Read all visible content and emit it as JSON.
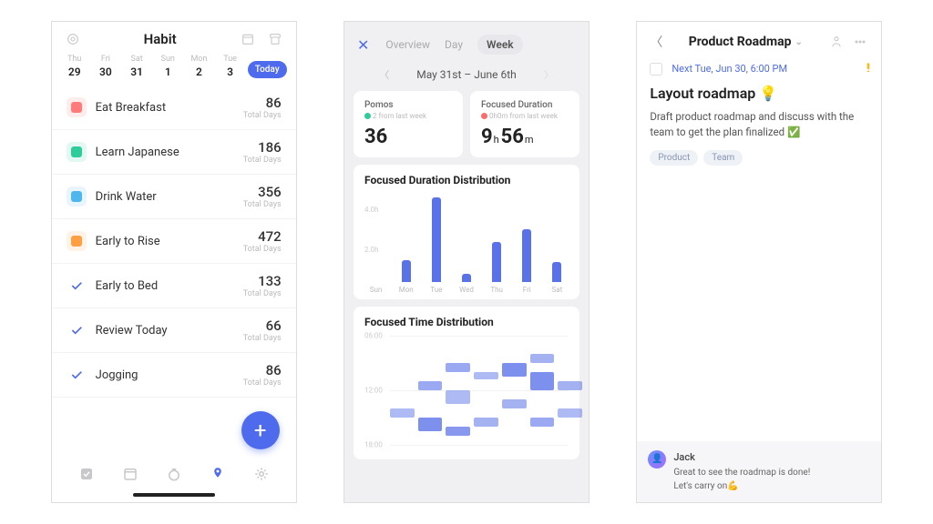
{
  "phone1": {
    "title": "Habit",
    "days": [
      {
        "dow": "Thu",
        "num": "29"
      },
      {
        "dow": "Fri",
        "num": "30"
      },
      {
        "dow": "Sat",
        "num": "31"
      },
      {
        "dow": "Sun",
        "num": "1"
      },
      {
        "dow": "Mon",
        "num": "2"
      },
      {
        "dow": "Tue",
        "num": "3"
      }
    ],
    "today_label": "Today",
    "habits": [
      {
        "title": "Eat Breakfast",
        "count": "86",
        "color": "#ff7b7b",
        "type": "box"
      },
      {
        "title": "Learn Japanese",
        "count": "186",
        "color": "#2ecc9b",
        "type": "box"
      },
      {
        "title": "Drink Water",
        "count": "356",
        "color": "#4fb7ed",
        "type": "box"
      },
      {
        "title": "Early to Rise",
        "count": "472",
        "color": "#ff9f43",
        "type": "box"
      },
      {
        "title": "Early to Bed",
        "count": "133",
        "color": "",
        "type": "check"
      },
      {
        "title": "Review Today",
        "count": "66",
        "color": "",
        "type": "check"
      },
      {
        "title": "Jogging",
        "count": "86",
        "color": "",
        "type": "check"
      }
    ],
    "sub_label": "Total Days",
    "fab": "+"
  },
  "phone2": {
    "tabs": [
      "Overview",
      "Day",
      "Week"
    ],
    "active_tab": "Week",
    "range": "May 31st – June 6th",
    "cards": [
      {
        "label": "Pomos",
        "delta": "2 from last week",
        "delta_color": "#2ecc9b",
        "value": "36"
      },
      {
        "label": "Focused Duration",
        "delta": "0h0m from last week",
        "delta_color": "#ff6b6b",
        "value_h": "9",
        "value_m": "56"
      }
    ],
    "chart1_title": "Focused Duration Distribution",
    "chart2_title": "Focused Time Distribution",
    "time_labels": [
      "06:00",
      "12:00",
      "18:00"
    ]
  },
  "phone3": {
    "title": "Product Roadmap",
    "due": "Next Tue, Jun 30, 6:00 PM",
    "priority": "!!",
    "task_title": "Layout roadmap",
    "task_emoji": "💡",
    "task_desc": "Draft product roadmap and discuss with the team to get the plan finalized ✅",
    "tags": [
      "Product",
      "Team"
    ],
    "comment": {
      "name": "Jack",
      "line1": "Great to see the roadmap is done!",
      "line2": "Let's carry on💪"
    }
  },
  "chart_data": [
    {
      "type": "bar",
      "title": "Focused Duration Distribution",
      "categories": [
        "Sun",
        "Mon",
        "Tue",
        "Wed",
        "Thu",
        "Fri",
        "Sat"
      ],
      "values": [
        0,
        1.1,
        4.2,
        0.4,
        2.0,
        2.6,
        1.0
      ],
      "ylabel": "h",
      "ylim": [
        0,
        4.5
      ],
      "yticks": [
        2.0,
        4.0
      ]
    },
    {
      "type": "heatmap",
      "title": "Focused Time Distribution",
      "x_categories": [
        "Sun",
        "Mon",
        "Tue",
        "Wed",
        "Thu",
        "Fri",
        "Sat"
      ],
      "y_labels": [
        "06:00",
        "12:00",
        "18:00"
      ],
      "blocks": [
        {
          "day": "Sun",
          "start": 14,
          "len": 1,
          "intensity": 0.4
        },
        {
          "day": "Mon",
          "start": 11,
          "len": 1,
          "intensity": 0.6
        },
        {
          "day": "Mon",
          "start": 15,
          "len": 1.5,
          "intensity": 0.9
        },
        {
          "day": "Tue",
          "start": 9,
          "len": 1,
          "intensity": 0.6
        },
        {
          "day": "Tue",
          "start": 12,
          "len": 1.5,
          "intensity": 0.4
        },
        {
          "day": "Tue",
          "start": 16,
          "len": 1,
          "intensity": 0.8
        },
        {
          "day": "Wed",
          "start": 10,
          "len": 0.8,
          "intensity": 0.4
        },
        {
          "day": "Wed",
          "start": 15,
          "len": 1,
          "intensity": 0.5
        },
        {
          "day": "Thu",
          "start": 9,
          "len": 1.5,
          "intensity": 0.9
        },
        {
          "day": "Thu",
          "start": 13,
          "len": 1,
          "intensity": 0.5
        },
        {
          "day": "Fri",
          "start": 8,
          "len": 1,
          "intensity": 0.5
        },
        {
          "day": "Fri",
          "start": 10,
          "len": 2,
          "intensity": 0.9
        },
        {
          "day": "Fri",
          "start": 15,
          "len": 1,
          "intensity": 0.6
        },
        {
          "day": "Sat",
          "start": 11,
          "len": 1,
          "intensity": 0.5
        },
        {
          "day": "Sat",
          "start": 14,
          "len": 1,
          "intensity": 0.4
        }
      ]
    }
  ]
}
